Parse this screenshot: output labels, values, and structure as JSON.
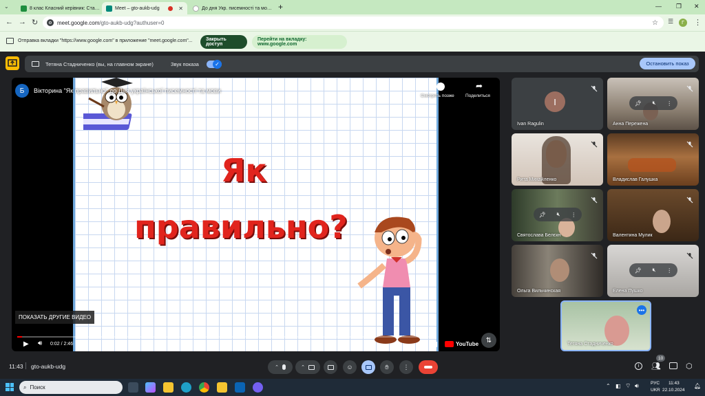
{
  "browser": {
    "tabs": [
      {
        "title": "8 клас Класний керівник: Ста…",
        "active": false
      },
      {
        "title": "Meet – gto-aukb-udg",
        "active": true
      },
      {
        "title": "До дня Укр. писемності та мо…",
        "active": false
      }
    ],
    "new_tab": "+",
    "url_host": "meet.google.com",
    "url_path": "/gto-aukb-udg?authuser=0"
  },
  "infobar": {
    "message": "Отправка вкладки \"https://www.google.com\" в приложение \"meet.google.com\"...",
    "close_access": "Закрыть доступ",
    "go_to_tab": "Перейти на вкладку: www.google.com"
  },
  "presenting_bar": {
    "presenter": "Тетяна Стадниченко (вы, на главном экране)",
    "sound_label": "Звук показа",
    "stop_button": "Остановить показ"
  },
  "video": {
    "channel_letter": "Б",
    "title": "Вікторина \"Як правильно\" до Дня української писемності та мови",
    "watch_later": "Смотреть позже",
    "share": "Поделиться",
    "slide_line1": "Як",
    "slide_line2": "правильно?",
    "more_videos": "ПОКАЗАТЬ ДРУГИЕ ВИДЕО",
    "time": "0:02 / 2:46",
    "progress_fraction": 0.012,
    "youtube_label": "YouTube"
  },
  "participants": [
    {
      "name": "Ivan Ragulin",
      "initial": "I",
      "muted": true
    },
    {
      "name": "Анна Переженa",
      "muted": true
    },
    {
      "name": "Рита Михайленко",
      "muted": true
    },
    {
      "name": "Владислав Галушка",
      "muted": true
    },
    {
      "name": "Святослава Белєкн",
      "muted": true
    },
    {
      "name": "Валентина Мулик",
      "muted": true
    },
    {
      "name": "Ольга Вильчинская",
      "muted": true
    },
    {
      "name": "Елена Пушко",
      "muted": true
    },
    {
      "name": "Тетяна Стадниченко",
      "muted": false
    }
  ],
  "bottom": {
    "clock": "11:43",
    "meeting_code": "gto-aukb-udg",
    "people_count": "10"
  },
  "taskbar": {
    "search_placeholder": "Поиск",
    "lang_top": "РУС",
    "lang_bottom": "UKR",
    "time": "11:43",
    "date": "22.10.2024"
  },
  "colors": {
    "accent_green": "#1e8e3e",
    "meet_dark": "#202124",
    "end_call_red": "#ea4335",
    "present_yellow": "#fbbc04",
    "slide_text_red": "#e1241d"
  }
}
